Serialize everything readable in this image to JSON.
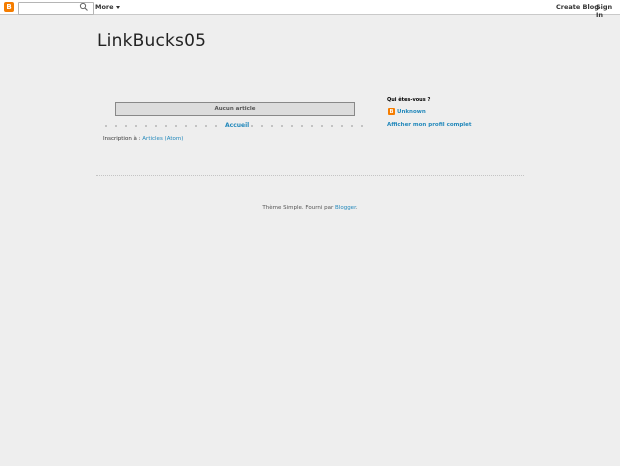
{
  "navbar": {
    "logo_letter": "B",
    "search_placeholder": "",
    "more_label": "More",
    "create_blog_label": "Create Blog",
    "sign_in_label": "Sign In"
  },
  "blog": {
    "title": "LinkBucks05"
  },
  "main": {
    "no_posts": "Aucun article",
    "home_link": "Accueil",
    "subscribe_prefix": "Inscription à : ",
    "subscribe_link": "Articles (Atom)"
  },
  "sidebar": {
    "about_heading": "Qui êtes-vous ?",
    "profile_name": "Unknown",
    "profile_link": "Afficher mon profil complet"
  },
  "footer": {
    "text_prefix": "Thème Simple. Fourni par ",
    "blogger_link": "Blogger",
    "text_suffix": "."
  },
  "colors": {
    "background": "#eeeeee",
    "link": "#2288bb",
    "brand": "#f57d00"
  }
}
